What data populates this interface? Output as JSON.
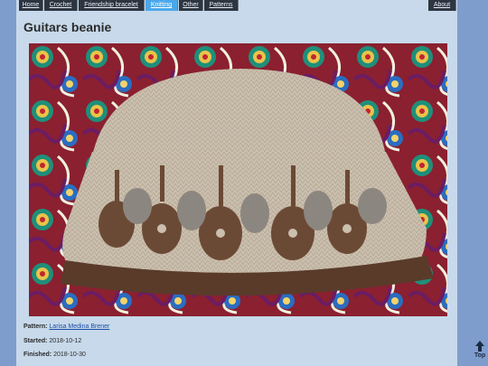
{
  "nav": {
    "items": [
      "Home",
      "Crochet",
      "Friendship bracelet",
      "Knitting",
      "Other",
      "Patterns"
    ],
    "active": "Knitting",
    "right": "About"
  },
  "page": {
    "title": "Guitars beanie"
  },
  "photo": {
    "subject": "knitted beanie with guitar colorwork"
  },
  "details": {
    "pattern_label": "Pattern:",
    "pattern_value": "Larisa Medina Brener",
    "started_label": "Started:",
    "started_value": "2018-10-12",
    "finished_label": "Finished:",
    "finished_value": "2018-10-30"
  },
  "scroll_top": {
    "label": "Top"
  },
  "colors": {
    "accent": "#4aa8ea",
    "nav_bg": "#2d3540",
    "page_bg": "#c7d9ea",
    "side_bg": "#7f9dcc"
  }
}
